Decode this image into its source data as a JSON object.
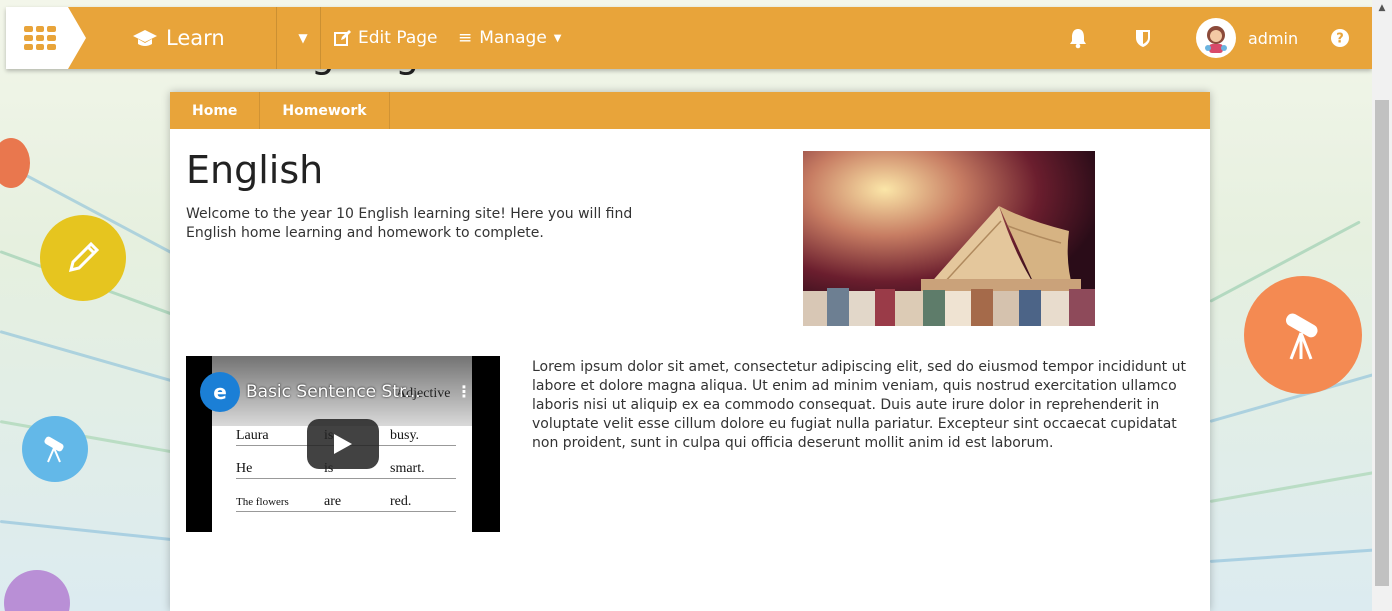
{
  "topbar": {
    "brand_label": "Learn",
    "edit_label": "Edit Page",
    "manage_label": "Manage",
    "user_name": "admin",
    "accent_color": "#e8a43a"
  },
  "site": {
    "title": "Learning English"
  },
  "tabs": [
    {
      "label": "Home"
    },
    {
      "label": "Homework"
    }
  ],
  "main": {
    "heading": "English",
    "intro": "Welcome to the year 10 English learning site! Here you will find English home learning and homework to complete.",
    "body_text": "Lorem ipsum dolor sit amet, consectetur adipiscing elit, sed do eiusmod tempor incididunt ut labore et dolore magna aliqua. Ut enim ad minim veniam, quis nostrud exercitation ullamco laboris nisi ut aliquip ex ea commodo consequat. Duis aute irure dolor in reprehenderit in voluptate velit esse cillum dolore eu fugiat nulla pariatur. Excepteur sint occaecat cupidatat non proident, sunt in culpa qui officia deserunt mollit anim id est laborum."
  },
  "video": {
    "channel_letter": "e",
    "title": "Basic Sentence Str...",
    "header_word": "Adjective",
    "rows": [
      {
        "subject": "Laura",
        "verb": "is",
        "adjective": "busy."
      },
      {
        "subject": "He",
        "verb": "is",
        "adjective": "smart."
      },
      {
        "subject": "The flowers",
        "verb": "are",
        "adjective": "red."
      }
    ]
  }
}
